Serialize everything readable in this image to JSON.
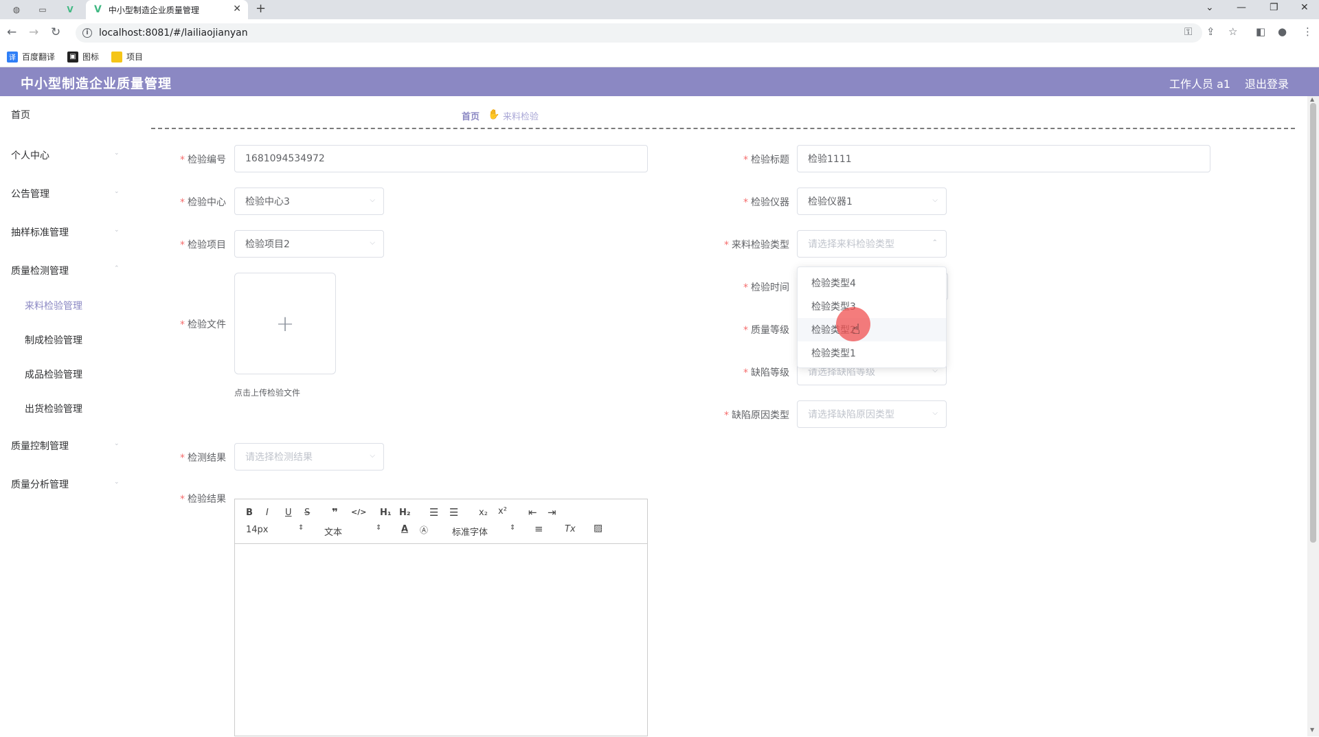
{
  "browser": {
    "tab_title": "中小型制造企业质量管理",
    "url": "localhost:8081/#/lailiaojianyan",
    "bookmarks": [
      "百度翻译",
      "图标",
      "项目"
    ]
  },
  "header": {
    "title": "中小型制造企业质量管理",
    "user": "工作人员 a1",
    "logout": "退出登录"
  },
  "sidebar": {
    "items": [
      "首页",
      "个人中心",
      "公告管理",
      "抽样标准管理",
      "质量检测管理",
      "质量控制管理",
      "质量分析管理"
    ],
    "sub_items": [
      "来料检验管理",
      "制成检验管理",
      "成品检验管理",
      "出货检验管理"
    ]
  },
  "breadcrumb": {
    "home": "首页",
    "current": "来料检验"
  },
  "form": {
    "code_label": "检验编号",
    "code_value": "1681094534972",
    "title_label": "检验标题",
    "title_value": "检验1111",
    "center_label": "检验中心",
    "center_value": "检验中心3",
    "instrument_label": "检验仪器",
    "instrument_value": "检验仪器1",
    "project_label": "检验项目",
    "project_value": "检验项目2",
    "type_label": "来料检验类型",
    "type_placeholder": "请选择来料检验类型",
    "time_label": "检验时间",
    "file_label": "检验文件",
    "upload_tip": "点击上传检验文件",
    "grade_label": "质量等级",
    "defect_label": "缺陷等级",
    "defect_placeholder": "请选择缺陷等级",
    "reason_label": "缺陷原因类型",
    "reason_placeholder": "请选择缺陷原因类型",
    "result_sel_label": "检测结果",
    "result_sel_placeholder": "请选择检测结果",
    "result_label": "检验结果"
  },
  "dropdown": {
    "options": [
      "检验类型4",
      "检验类型3",
      "检验类型2",
      "检验类型1"
    ]
  },
  "editor": {
    "font_size": "14px",
    "text_type": "文本",
    "font_family": "标准字体"
  },
  "colors": {
    "brand": "#8b88c3",
    "required": "#f56c6c"
  }
}
